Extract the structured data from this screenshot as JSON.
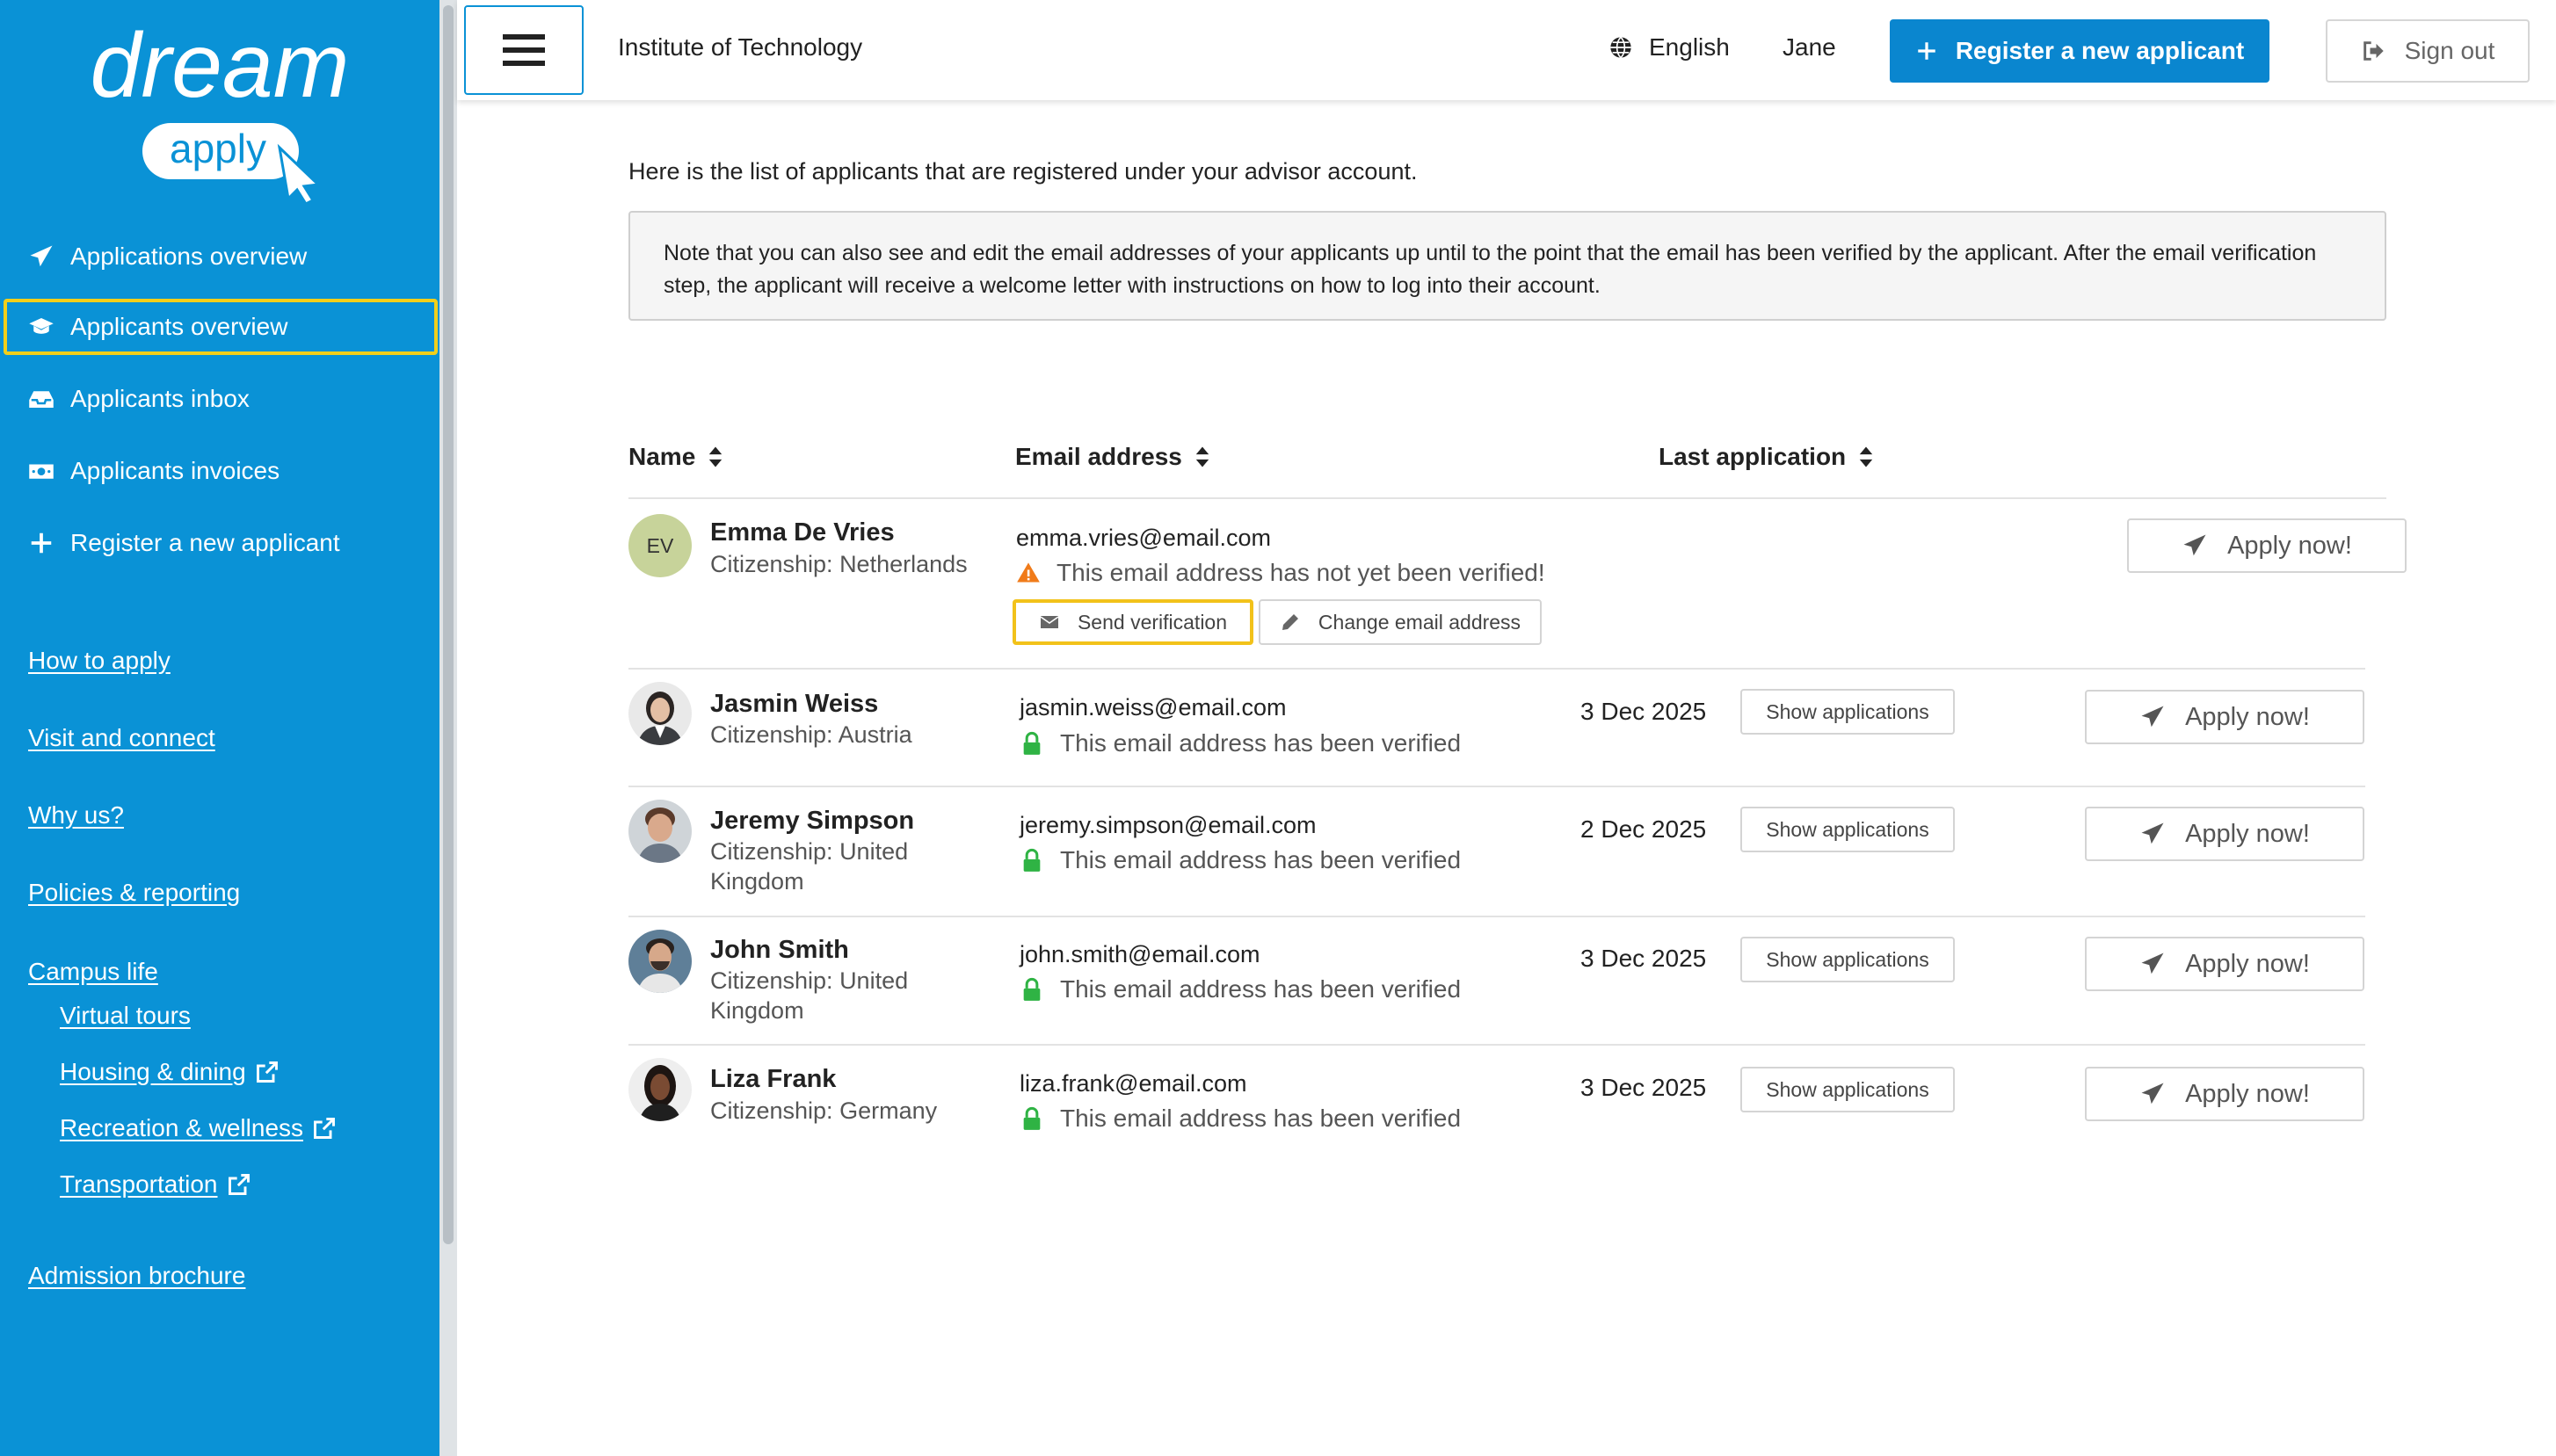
{
  "app": {
    "logo_main": "dream",
    "logo_sub": "apply",
    "institute": "Institute of Technology",
    "language": "English",
    "user": "Jane",
    "register_label": "Register a new applicant",
    "signout_label": "Sign out"
  },
  "sidebar": {
    "items": [
      {
        "label": "Applications overview",
        "icon": "paper-plane-icon"
      },
      {
        "label": "Applicants overview",
        "icon": "graduation-cap-icon",
        "active": true
      },
      {
        "label": "Applicants inbox",
        "icon": "inbox-icon"
      },
      {
        "label": "Applicants invoices",
        "icon": "money-bill-icon"
      },
      {
        "label": "Register a new applicant",
        "icon": "plus-icon"
      }
    ],
    "links": [
      {
        "label": "How to apply"
      },
      {
        "label": "Visit and connect"
      },
      {
        "label": "Why us?"
      },
      {
        "label": "Policies & reporting"
      },
      {
        "label": "Campus life"
      },
      {
        "label": "Virtual tours"
      },
      {
        "label": "Housing & dining",
        "external": true
      },
      {
        "label": "Recreation & wellness",
        "external": true
      },
      {
        "label": "Transportation",
        "external": true
      },
      {
        "label": "Admission brochure"
      }
    ]
  },
  "main": {
    "intro": "Here is the list of applicants that are registered under your advisor account.",
    "note": "Note that you can also see and edit the email addresses of your applicants up until to the point that the email has been verified by the applicant. After the email verification step, the applicant will receive a welcome letter with instructions on how to log into their account."
  },
  "table": {
    "headers": [
      "Name",
      "Email address",
      "Last application"
    ],
    "show_label": "Show applications",
    "apply_label": "Apply now!",
    "send_verification_label": "Send verification",
    "change_email_label": "Change email address",
    "rows": [
      {
        "initials": "EV",
        "name": "Emma De Vries",
        "citizenship": "Citizenship: Netherlands",
        "email": "emma.vries@email.com",
        "status": "This email address has not yet been verified!",
        "verified": false,
        "date": ""
      },
      {
        "name": "Jasmin Weiss",
        "citizenship": "Citizenship: Austria",
        "email": "jasmin.weiss@email.com",
        "status": "This email address has been verified",
        "verified": true,
        "date": "3 Dec 2025"
      },
      {
        "name": "Jeremy Simpson",
        "citizenship": "Citizenship: United Kingdom",
        "email": "jeremy.simpson@email.com",
        "status": "This email address has been verified",
        "verified": true,
        "date": "2 Dec 2025"
      },
      {
        "name": "John Smith",
        "citizenship": "Citizenship: United Kingdom",
        "email": "john.smith@email.com",
        "status": "This email address has been verified",
        "verified": true,
        "date": "3 Dec 2025"
      },
      {
        "name": "Liza Frank",
        "citizenship": "Citizenship: Germany",
        "email": "liza.frank@email.com",
        "status": "This email address has been verified",
        "verified": true,
        "date": "3 Dec 2025"
      }
    ]
  },
  "colors": {
    "sidebar_bg": "#0a92d6",
    "primary_button": "#0a86cf",
    "highlight": "#f2cf1a",
    "verified_green": "#2fb344",
    "warning_orange": "#f07b1a"
  }
}
